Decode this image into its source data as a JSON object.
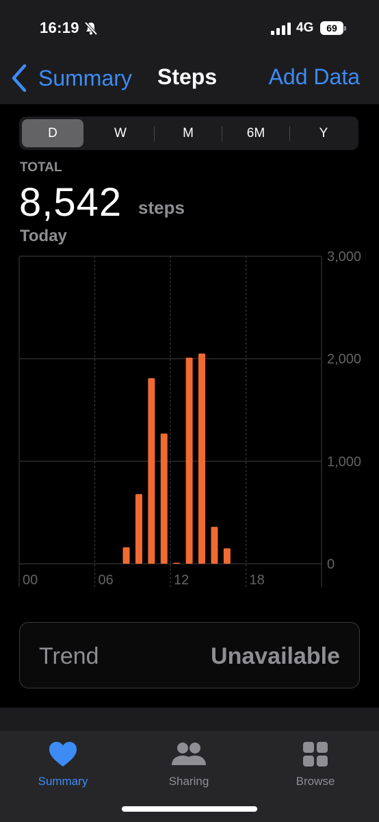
{
  "status": {
    "time": "16:19",
    "network": "4G",
    "battery": "69"
  },
  "nav": {
    "back_label": "Summary",
    "title": "Steps",
    "add_label": "Add Data"
  },
  "segments": [
    "D",
    "W",
    "M",
    "6M",
    "Y"
  ],
  "active_segment": "D",
  "total": {
    "label": "TOTAL",
    "value": "8,542",
    "unit": "steps",
    "date": "Today"
  },
  "chart_data": {
    "type": "bar",
    "x": [
      8,
      9,
      10,
      11,
      12,
      13,
      14,
      15,
      16
    ],
    "values": [
      160,
      680,
      1810,
      1270,
      10,
      2010,
      2050,
      360,
      150
    ],
    "ylim": [
      0,
      3000
    ],
    "xlim": [
      0,
      24
    ],
    "yticks": [
      "0",
      "1,000",
      "2,000",
      "3,000"
    ],
    "ytick_values": [
      0,
      1000,
      2000,
      3000
    ],
    "xticks": [
      "00",
      "06",
      "12",
      "18"
    ],
    "xtick_values": [
      0,
      6,
      12,
      18
    ],
    "color": "#f06a33"
  },
  "trend": {
    "label": "Trend",
    "value": "Unavailable"
  },
  "tabs": [
    {
      "label": "Summary",
      "icon": "heart-icon",
      "active": true
    },
    {
      "label": "Sharing",
      "icon": "people-icon",
      "active": false
    },
    {
      "label": "Browse",
      "icon": "grid-icon",
      "active": false
    }
  ],
  "colors": {
    "accent": "#3d8cf6",
    "bar": "#f06a33"
  }
}
